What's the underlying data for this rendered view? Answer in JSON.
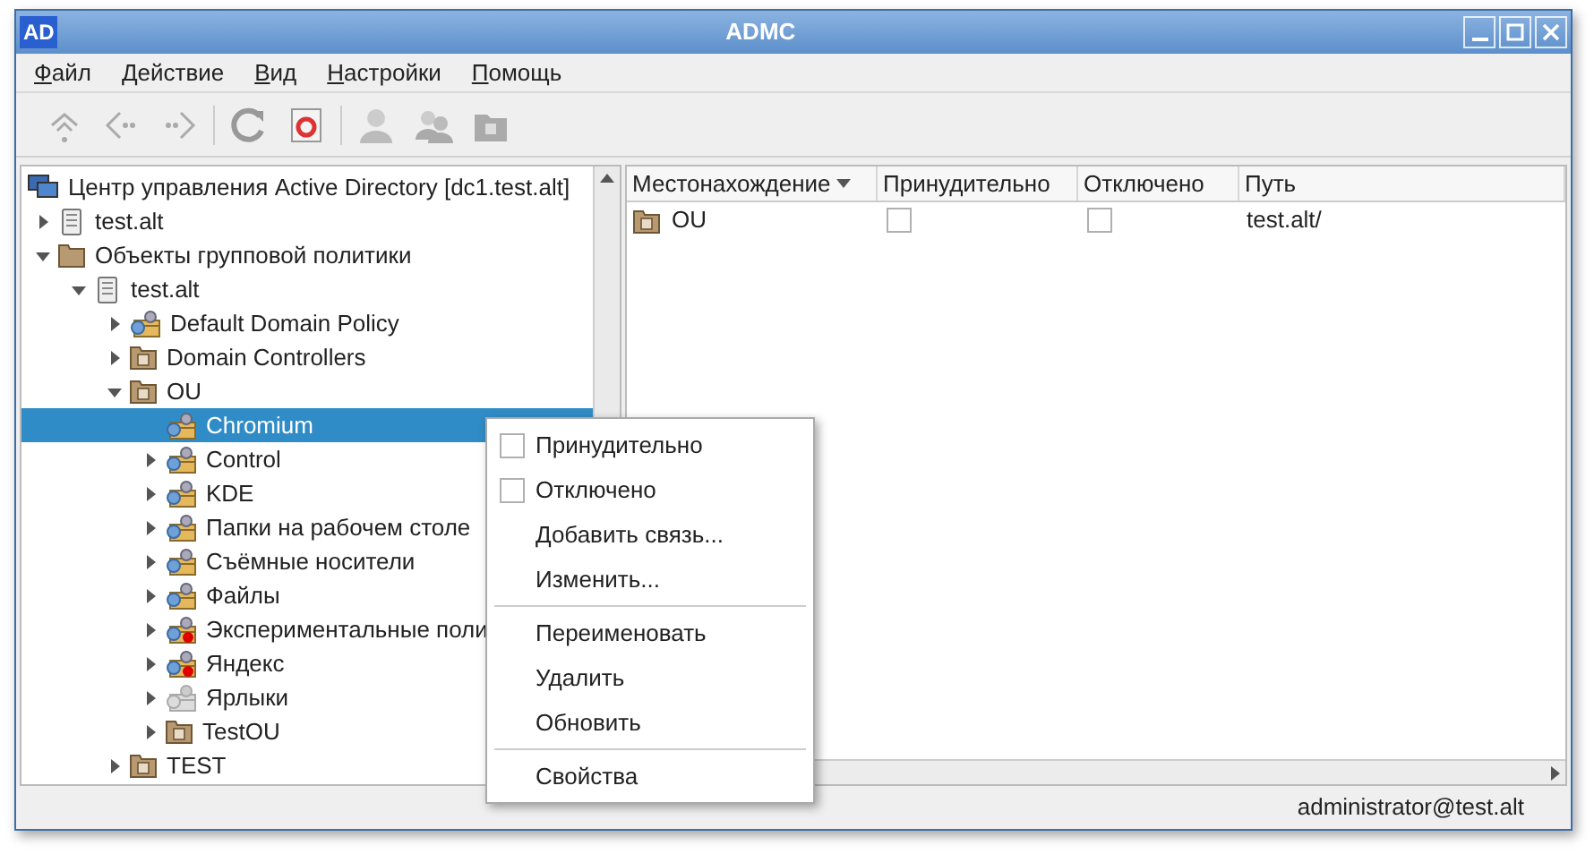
{
  "window": {
    "app_icon": "AD",
    "title": "ADMC"
  },
  "menu": [
    {
      "label": "Файл"
    },
    {
      "label": "Действие"
    },
    {
      "label": "Вид"
    },
    {
      "label": "Настройки"
    },
    {
      "label": "Помощь"
    }
  ],
  "tree": {
    "label": "Центр управления Active Directory [dc1.test.alt]",
    "kind": "console",
    "selected": false,
    "children": [
      {
        "label": "test.alt",
        "kind": "domain",
        "expanded": false,
        "selected": false
      },
      {
        "label": "Объекты групповой политики",
        "kind": "folder",
        "expanded": true,
        "selected": false,
        "children": [
          {
            "label": "test.alt",
            "kind": "domain",
            "expanded": true,
            "selected": false,
            "children": [
              {
                "label": "Default Domain Policy",
                "kind": "gpo",
                "expanded": false,
                "selected": false
              },
              {
                "label": "Domain Controllers",
                "kind": "ou",
                "expanded": false,
                "selected": false
              },
              {
                "label": "OU",
                "kind": "ou",
                "expanded": true,
                "selected": false,
                "children": [
                  {
                    "label": "Chromium",
                    "kind": "gpo",
                    "selected": true
                  },
                  {
                    "label": "Control",
                    "kind": "gpo",
                    "expanded": false,
                    "selected": false
                  },
                  {
                    "label": "KDE",
                    "kind": "gpo",
                    "expanded": false,
                    "selected": false
                  },
                  {
                    "label": "Папки на рабочем столе",
                    "kind": "gpo",
                    "expanded": false,
                    "selected": false
                  },
                  {
                    "label": "Съёмные носители",
                    "kind": "gpo",
                    "expanded": false,
                    "selected": false
                  },
                  {
                    "label": "Файлы",
                    "kind": "gpo",
                    "expanded": false,
                    "selected": false
                  },
                  {
                    "label": "Экспериментальные поли",
                    "kind": "gpo-error",
                    "expanded": false,
                    "selected": false
                  },
                  {
                    "label": "Яндекс",
                    "kind": "gpo-error",
                    "expanded": false,
                    "selected": false
                  },
                  {
                    "label": "Ярлыки",
                    "kind": "gpo-disabled",
                    "expanded": false,
                    "selected": false
                  },
                  {
                    "label": "TestOU",
                    "kind": "ou",
                    "expanded": false,
                    "selected": false
                  }
                ]
              },
              {
                "label": "TEST",
                "kind": "ou",
                "expanded": false,
                "selected": false
              }
            ]
          }
        ]
      }
    ]
  },
  "table": {
    "columns": [
      {
        "label": "Местонахождение",
        "sorted": true
      },
      {
        "label": "Принудительно",
        "sorted": false
      },
      {
        "label": "Отключено",
        "sorted": false
      },
      {
        "label": "Путь",
        "sorted": false
      }
    ],
    "rows": [
      {
        "name": "OU",
        "kind": "ou",
        "enforced": false,
        "disabled": false,
        "path": "test.alt/"
      }
    ]
  },
  "context_menu": [
    {
      "kind": "checkbox",
      "label": "Принудительно",
      "checked": false
    },
    {
      "kind": "checkbox",
      "label": "Отключено",
      "checked": false
    },
    {
      "kind": "action",
      "label": "Добавить связь..."
    },
    {
      "kind": "action",
      "label": "Изменить..."
    },
    {
      "kind": "separator"
    },
    {
      "kind": "action",
      "label": "Переименовать"
    },
    {
      "kind": "action",
      "label": "Удалить"
    },
    {
      "kind": "action",
      "label": "Обновить"
    },
    {
      "kind": "separator"
    },
    {
      "kind": "action",
      "label": "Свойства"
    }
  ],
  "status_bar": {
    "user": "administrator@test.alt"
  }
}
